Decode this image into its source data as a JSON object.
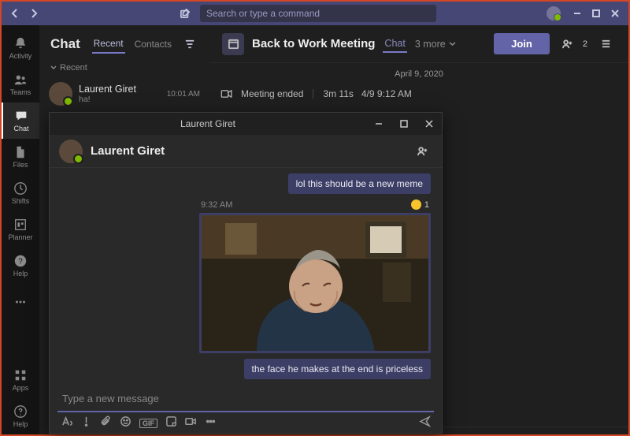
{
  "titlebar": {
    "search_placeholder": "Search or type a command"
  },
  "rail": {
    "activity": "Activity",
    "teams": "Teams",
    "chat": "Chat",
    "files": "Files",
    "shifts": "Shifts",
    "planner": "Planner",
    "help": "Help",
    "apps": "Apps",
    "help2": "Help"
  },
  "chatlist": {
    "title": "Chat",
    "tab_recent": "Recent",
    "tab_contacts": "Contacts",
    "section_recent": "Recent",
    "items": [
      {
        "name": "Laurent Giret",
        "preview": "ha!",
        "time": "10:01 AM"
      }
    ]
  },
  "main": {
    "title": "Back to Work Meeting",
    "tab_chat": "Chat",
    "more_label": "3 more",
    "join": "Join",
    "participants_count": "2",
    "date_chip": "April 9, 2020",
    "meeting_ended": "Meeting ended",
    "meeting_duration": "3m 11s",
    "meeting_time": "4/9 9:12 AM"
  },
  "popout": {
    "title": "Laurent Giret",
    "header_name": "Laurent Giret",
    "truncated_bubble": "lol this should be a new meme",
    "media_time": "9:32 AM",
    "reaction_count": "1",
    "caption_bubble": "the face he makes at the end is priceless",
    "compose_placeholder": "Type a new message",
    "gif_label": "GIF"
  }
}
